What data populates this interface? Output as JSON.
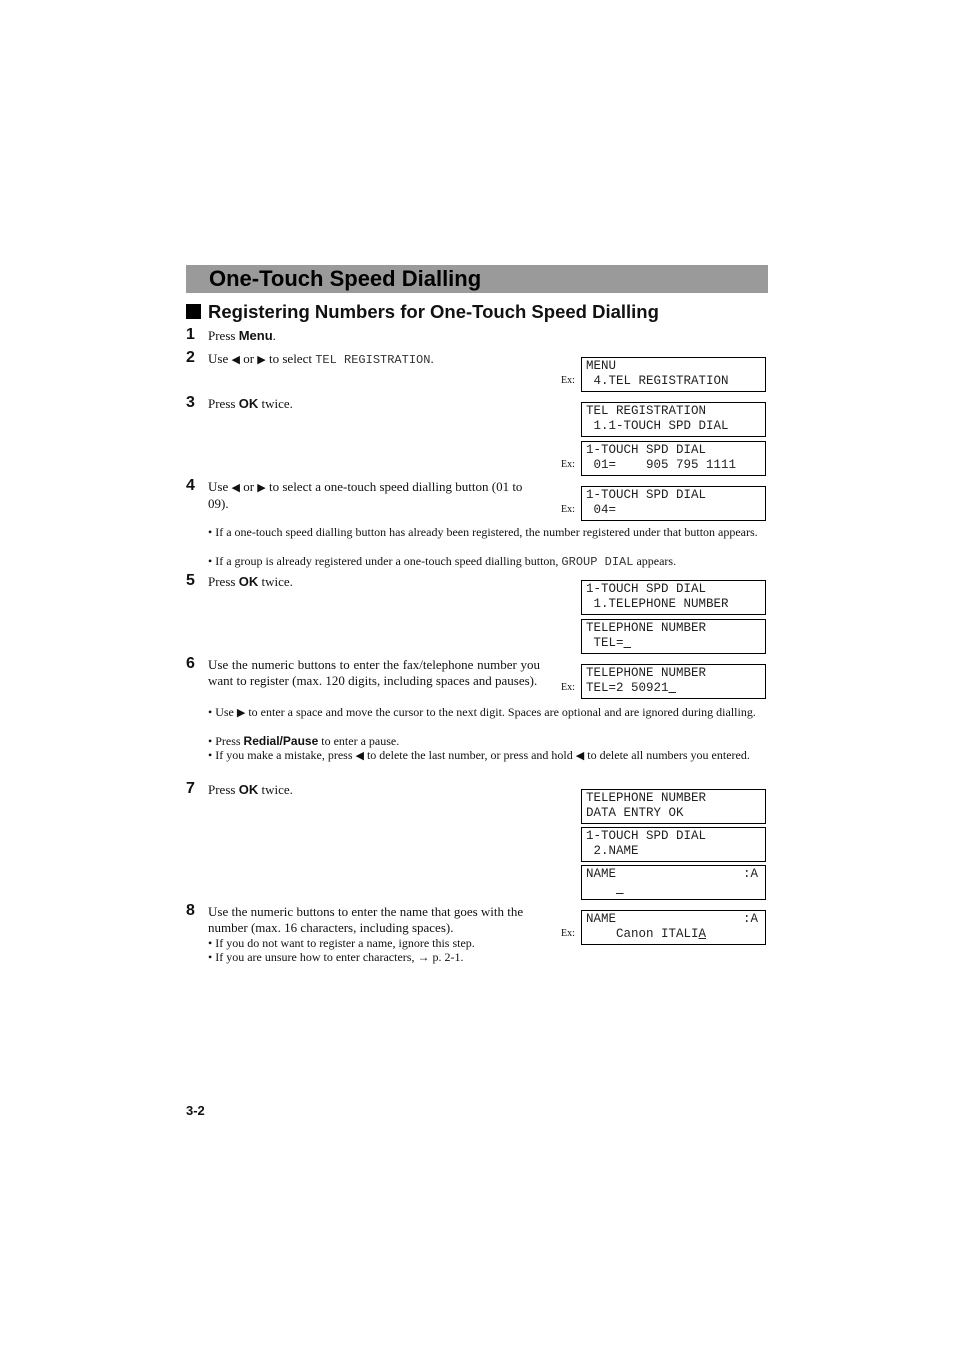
{
  "header": {
    "title": "One-Touch Speed Dialling"
  },
  "section": {
    "title": "Registering Numbers for One-Touch Speed Dialling"
  },
  "steps": [
    {
      "num": "1",
      "width": 330,
      "segs": [
        [
          "Press ",
          ""
        ],
        [
          "Menu",
          "b"
        ],
        [
          ".",
          ""
        ]
      ]
    },
    {
      "num": "2",
      "width": 340,
      "segs": [
        [
          "Use ",
          ""
        ],
        [
          "◀",
          "a"
        ],
        [
          " or ",
          ""
        ],
        [
          "▶",
          "a"
        ],
        [
          " to select ",
          ""
        ],
        [
          "TEL REGISTRATION",
          "m"
        ],
        [
          ".",
          ""
        ]
      ]
    },
    {
      "num": "3",
      "width": 330,
      "segs": [
        [
          "Press ",
          ""
        ],
        [
          "OK",
          "b"
        ],
        [
          " twice.",
          ""
        ]
      ]
    },
    {
      "num": "4",
      "width": 332,
      "segs": [
        [
          "Use ",
          ""
        ],
        [
          "◀",
          "a"
        ],
        [
          " or ",
          ""
        ],
        [
          "▶",
          "a"
        ],
        [
          " to select a one-touch speed dialling button (01 to 09).",
          ""
        ]
      ]
    },
    {
      "num": "5",
      "width": 330,
      "segs": [
        [
          "Press ",
          ""
        ],
        [
          "OK",
          "b"
        ],
        [
          " twice.",
          ""
        ]
      ]
    },
    {
      "num": "6",
      "width": 332,
      "segs": [
        [
          "Use the numeric buttons to enter the fax/telephone number you want to register (max. 120 digits, including spaces and pauses).",
          ""
        ]
      ]
    },
    {
      "num": "7",
      "width": 330,
      "segs": [
        [
          "Press ",
          ""
        ],
        [
          "OK",
          "b"
        ],
        [
          " twice.",
          ""
        ]
      ]
    },
    {
      "num": "8",
      "width": 335,
      "segs": [
        [
          "Use the numeric buttons to enter the name that goes with the number (max. 16 characters, including spaces).",
          ""
        ]
      ]
    }
  ],
  "bullets": [
    {
      "segs": [
        [
          "• If a one-touch speed dialling button has already been registered, the number registered under that button appears.",
          ""
        ]
      ]
    },
    {
      "segs": [
        [
          "• If a group is already registered under a one-touch speed dialling button, ",
          ""
        ],
        [
          "GROUP DIAL",
          "m"
        ],
        [
          " appears.",
          ""
        ]
      ]
    },
    {
      "segs": [
        [
          "• Use ",
          ""
        ],
        [
          "▶",
          "a"
        ],
        [
          " to enter a space and move the cursor to the next digit. Spaces are optional and are ignored during dialling.",
          ""
        ]
      ]
    },
    {
      "segs": [
        [
          "• Press ",
          ""
        ],
        [
          "Redial/Pause",
          "b"
        ],
        [
          "  to enter a pause.",
          ""
        ]
      ]
    },
    {
      "segs": [
        [
          "• If you make a mistake, press ",
          ""
        ],
        [
          "◀",
          "a"
        ],
        [
          " to delete the last number, or press and hold ",
          ""
        ],
        [
          "◀",
          "a"
        ],
        [
          " to delete all numbers you entered.",
          ""
        ]
      ]
    },
    {
      "segs": [
        [
          "• If you do not want to register a name, ignore this step.",
          ""
        ]
      ]
    },
    {
      "segs": [
        [
          "• If you are unsure how to enter characters, → p. 2-1.",
          ""
        ]
      ]
    }
  ],
  "lcds": [
    {
      "l1": "MENU",
      "l2": " 4.TEL REGISTRATION",
      "ex": "Ex:"
    },
    {
      "l1": "TEL REGISTRATION",
      "l2": " 1.1-TOUCH SPD DIAL"
    },
    {
      "l1": "1-TOUCH SPD DIAL",
      "l2": " 01=    905 795 1111",
      "ex": "Ex:"
    },
    {
      "l1": "1-TOUCH SPD DIAL",
      "l2": " 04=",
      "ex": "Ex:"
    },
    {
      "l1": "1-TOUCH SPD DIAL",
      "l2": " 1.TELEPHONE NUMBER"
    },
    {
      "l1": "TELEPHONE NUMBER",
      "l2": " TEL=",
      "cursor": " "
    },
    {
      "l1": "TELEPHONE NUMBER",
      "l2": "TEL=2 50921",
      "cursor": " ",
      "ex": "Ex:"
    },
    {
      "l1": "TELEPHONE NUMBER",
      "l2": "DATA ENTRY OK"
    },
    {
      "l1": "1-TOUCH SPD DIAL",
      "l2": " 2.NAME"
    },
    {
      "l1": "NAME",
      "r": ":A",
      "l2": "    ",
      "cursor": " "
    },
    {
      "l1": "NAME",
      "r": ":A",
      "l2": "    Canon ITALI",
      "cursor": "A",
      "ex": "Ex:"
    }
  ],
  "footer": {
    "page_number": "3-2"
  }
}
